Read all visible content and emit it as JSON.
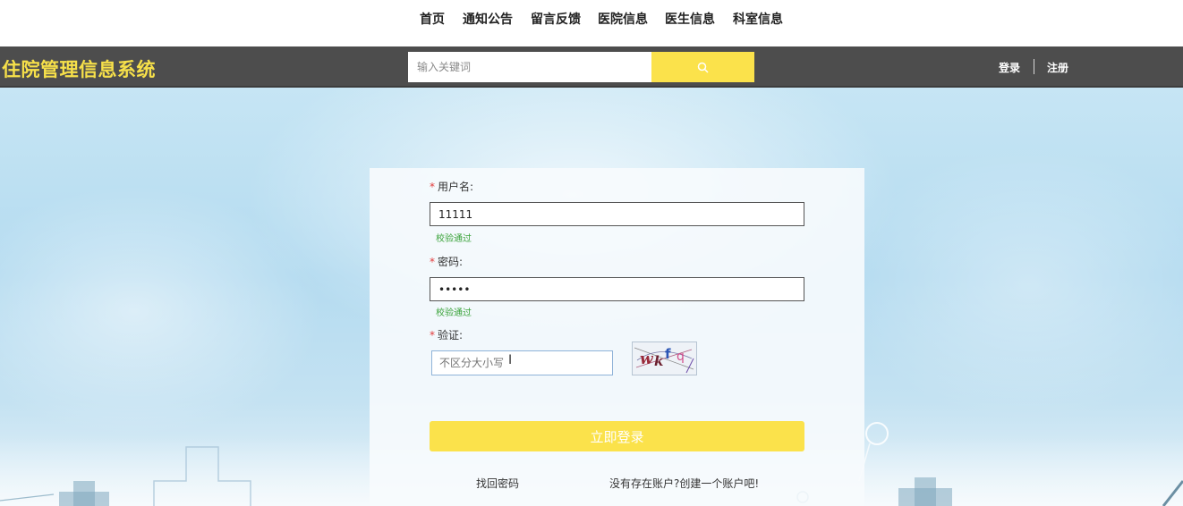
{
  "nav": {
    "items": [
      "首页",
      "通知公告",
      "留言反馈",
      "医院信息",
      "医生信息",
      "科室信息"
    ]
  },
  "header": {
    "logo": "住院管理信息系统",
    "search_placeholder": "输入关键词",
    "search_icon": "search-icon",
    "login": "登录",
    "register": "注册"
  },
  "form": {
    "username_label": "用户名:",
    "username_value": "11111",
    "username_status": "校验通过",
    "password_label": "密码:",
    "password_value": "•••••",
    "password_status": "校验通过",
    "captcha_label": "验证:",
    "captcha_placeholder": "不区分大小写",
    "captcha_text": "wkfq",
    "required_mark": "*",
    "submit": "立即登录",
    "forgot": "找回密码",
    "register_prompt": "没有存在账户?创建一个账户吧!"
  },
  "colors": {
    "accent": "#fbe24b",
    "header_bg": "#4d4d4d",
    "logo": "#f6e04a",
    "valid": "#3aa33a",
    "required": "#e23b3b"
  }
}
